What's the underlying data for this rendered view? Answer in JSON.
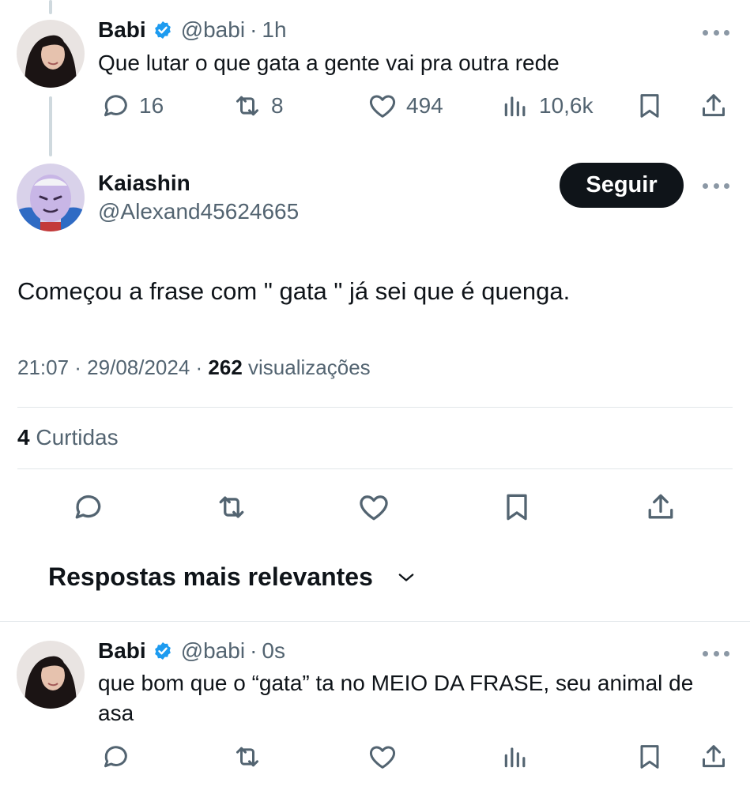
{
  "tweet1": {
    "name": "Babi",
    "handle": "@babi",
    "sep": "·",
    "time": "1h",
    "text": "Que lutar o que gata a gente vai pra outra rede",
    "replies": "16",
    "retweets": "8",
    "likes": "494",
    "views": "10,6k"
  },
  "main_tweet": {
    "name": "Kaiashin",
    "handle": "@Alexand45624665",
    "follow_label": "Seguir",
    "text": "Começou a frase com \" gata \" já sei que é quenga.",
    "timestamp": "21:07 · 29/08/2024 · ",
    "view_count": "262",
    "view_label": " visualizações",
    "like_count": "4",
    "like_label": " Curtidas"
  },
  "replies_header": {
    "label": "Respostas mais relevantes"
  },
  "reply1": {
    "name": "Babi",
    "handle": "@babi",
    "sep": "·",
    "time": "0s",
    "text_line1": "que bom que o “gata” ta no MEIO DA FRASE, seu animal de",
    "text_line2": "asa"
  },
  "colors": {
    "text": "#0f1419",
    "muted": "#536471",
    "verified": "#1d9bf0",
    "button": "#0f1419",
    "divider": "#e1e6e9"
  },
  "icons": {
    "reply": "speech-bubble-icon",
    "retweet": "retweet-icon",
    "like": "heart-icon",
    "views": "bar-chart-icon",
    "bookmark": "bookmark-icon",
    "share": "share-icon",
    "more": "more-dots-icon",
    "verified": "verified-badge-icon",
    "chevron": "chevron-down-icon"
  }
}
